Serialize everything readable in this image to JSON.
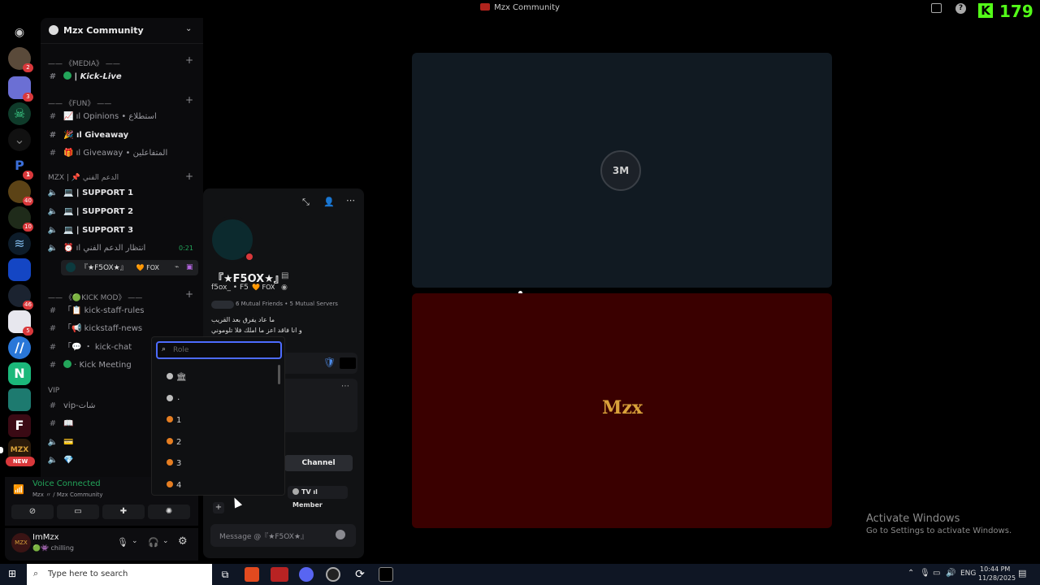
{
  "app": {
    "title": "Mzx Community",
    "kick_count": "179"
  },
  "server": {
    "name": "Mzx Community"
  },
  "servers": {
    "badges": [
      "2",
      "3",
      "1",
      "40",
      "10",
      "46",
      "5"
    ],
    "new_label": "NEW"
  },
  "categories": {
    "media": "—— 《MEDIA》 ——",
    "fun": "—— 《FUN》 ——",
    "mzx": "MZX | 📌 الدعم الفني",
    "kickmod": "—— 《🟢KICK MOD》 ——",
    "vip": "VIP"
  },
  "channels": [
    {
      "label": "Kick-Live"
    },
    {
      "label": "ıl Opinions • استطلاع"
    },
    {
      "label": "ıl Giveaway"
    },
    {
      "label": "ıl Giveaway • المتفاعلين"
    },
    {
      "label": "SUPPORT 1"
    },
    {
      "label": "SUPPORT 2"
    },
    {
      "label": "SUPPORT 3"
    },
    {
      "label": "ıl انتظار الدعم الفني",
      "time": "0:21"
    },
    {
      "label": "kick-staff-rules"
    },
    {
      "label": "kickstaff-news"
    },
    {
      "label": "・ kick-chat"
    },
    {
      "label": "Kick Meeting"
    },
    {
      "label": "vip-شات"
    }
  ],
  "voice_user": {
    "name": "『★F5OX★』",
    "tag": "🧡 FOX"
  },
  "voice": {
    "status": "Voice Connected",
    "sub": "Mzx 〃 / Mzx Community"
  },
  "user": {
    "name": "ImMzx",
    "status": "chilling"
  },
  "profile": {
    "display_name": "『★F5OX★』",
    "username": "f5ox_ • F5",
    "tag": "🧡 FOX",
    "mutual": "6 Mutual Friends • 5 Mutual Servers",
    "bio1": "ما عاد يفرق بعد القريب",
    "bio2": "و انا فاقد اعز ما املك فلا تلوموني",
    "channel_btn": "Channel",
    "role_tv": "TV ıl Member",
    "message_placeholder": "Message @『★F5OX★』"
  },
  "role_picker": {
    "placeholder": "Role",
    "roles": [
      {
        "label": "🏛",
        "color": "#bdbdbd"
      },
      {
        "label": "٠",
        "color": "#bdbdbd"
      },
      {
        "label": "1",
        "color": "#e67e22"
      },
      {
        "label": "2",
        "color": "#e67e22"
      },
      {
        "label": "3",
        "color": "#e67e22"
      },
      {
        "label": "4",
        "color": "#e67e22"
      }
    ]
  },
  "stage": {
    "center_logo": "3M",
    "lower_logo": "Mzx"
  },
  "windows": {
    "activate_title": "Activate Windows",
    "activate_sub": "Go to Settings to activate Windows.",
    "search_placeholder": "Type here to search",
    "lang": "ENG",
    "time": "10:44 PM",
    "date": "11/28/2025"
  }
}
